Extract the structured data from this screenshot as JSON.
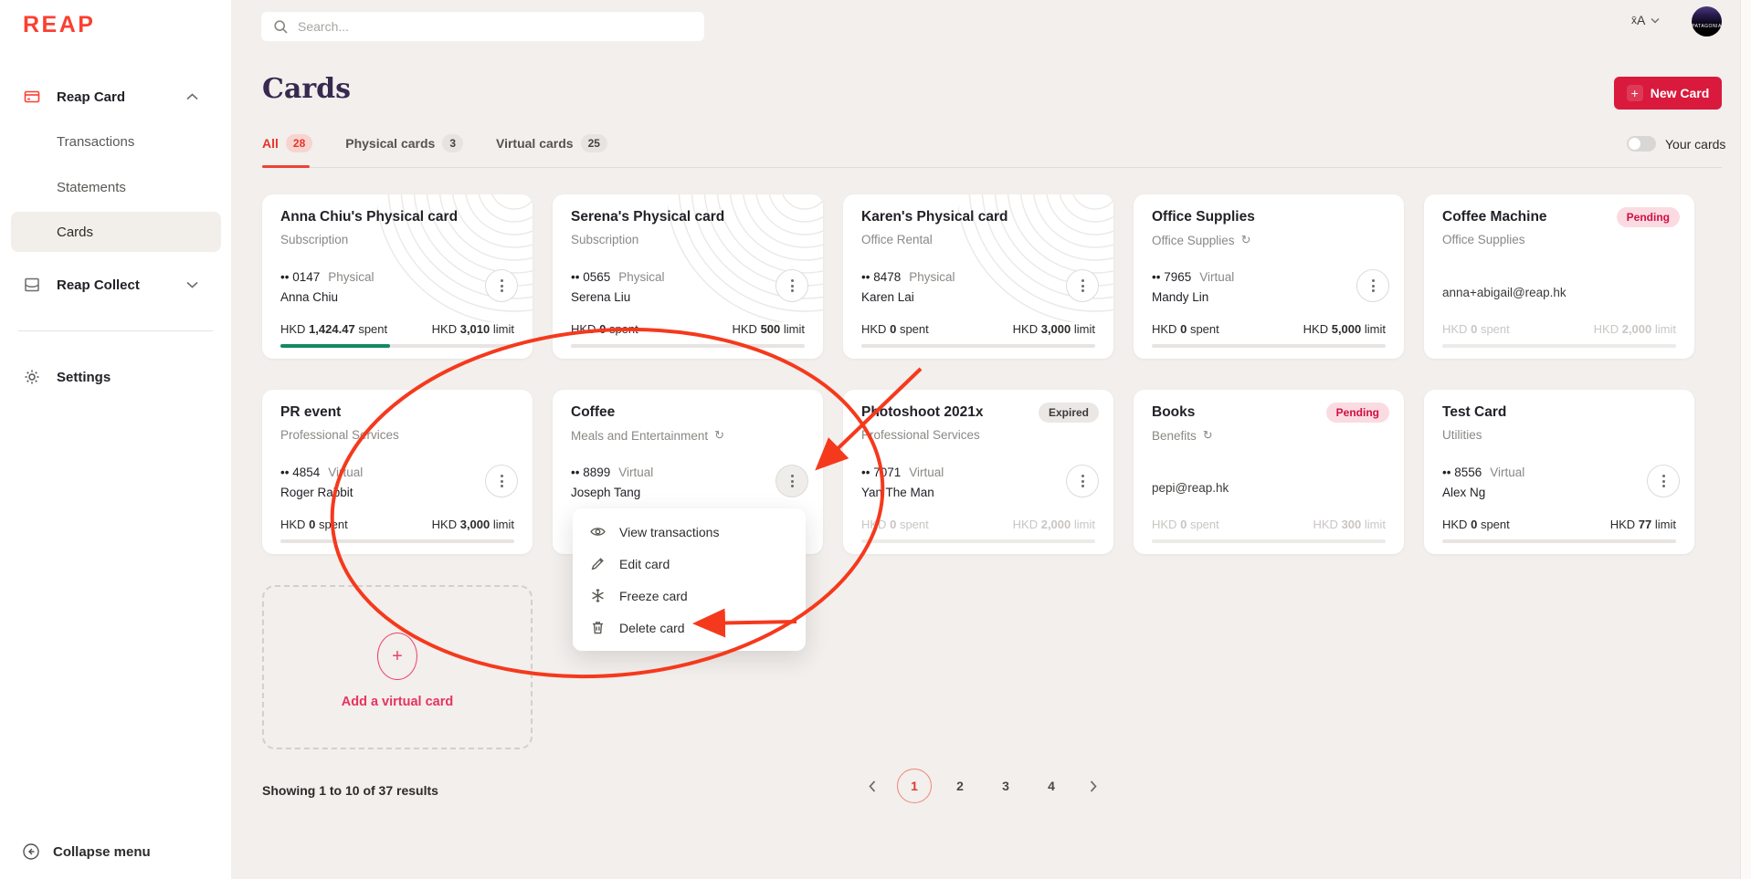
{
  "colors": {
    "brand_red": "#fb3f30",
    "button_red": "#d91a3c",
    "tab_active_red": "#e5352b",
    "pending_bg": "#fbdbe2",
    "pending_text": "#cf0f42",
    "progress_green": "#108a63",
    "annotation_red": "#f5391d",
    "heading_purple": "#37294f",
    "background": "#f2efec"
  },
  "icons": {
    "recurring": "↻",
    "lang_x": "x̄",
    "lang_a": "A",
    "plus": "+",
    "avatar_label": "PATAGONIA"
  },
  "labels": {
    "currency": "HKD",
    "spent": "spent",
    "limit": "limit"
  },
  "sidebar": {
    "logo": "REAP",
    "reap_card": "Reap Card",
    "transactions": "Transactions",
    "statements": "Statements",
    "cards": "Cards",
    "reap_collect": "Reap Collect",
    "settings": "Settings",
    "collapse": "Collapse menu"
  },
  "topbar": {
    "search_placeholder": "Search..."
  },
  "header": {
    "title": "Cards",
    "new_card": "New Card"
  },
  "tabs": {
    "all": {
      "label": "All",
      "count": "28"
    },
    "physical": {
      "label": "Physical cards",
      "count": "3"
    },
    "virtual": {
      "label": "Virtual cards",
      "count": "25"
    },
    "your_cards": "Your cards"
  },
  "cards": [
    {
      "title": "Anna Chiu's Physical card",
      "category": "Subscription",
      "number": "•• 0147",
      "kind": "Physical",
      "holder": "Anna Chiu",
      "spent": "1,424.47",
      "limit": "3,010",
      "progress_style": "width:47%"
    },
    {
      "title": "Serena's Physical card",
      "category": "Subscription",
      "number": "•• 0565",
      "kind": "Physical",
      "holder": "Serena Liu",
      "spent": "0",
      "limit": "500"
    },
    {
      "title": "Karen's Physical card",
      "category": "Office Rental",
      "number": "•• 8478",
      "kind": "Physical",
      "holder": "Karen Lai",
      "spent": "0",
      "limit": "3,000"
    },
    {
      "title": "Office Supplies",
      "category": "Office Supplies",
      "number": "•• 7965",
      "kind": "Virtual",
      "holder": "Mandy Lin",
      "spent": "0",
      "limit": "5,000"
    },
    {
      "title": "Coffee Machine",
      "badge": "Pending",
      "category": "Office Supplies",
      "email": "anna+abigail@reap.hk",
      "spent": "0",
      "limit": "2,000"
    },
    {
      "title": "PR event",
      "category": "Professional Services",
      "number": "•• 4854",
      "kind": "Virtual",
      "holder": "Roger Rabbit",
      "spent": "0",
      "limit": "3,000"
    },
    {
      "title": "Coffee",
      "category": "Meals and Entertainment",
      "number": "•• 8899",
      "kind": "Virtual",
      "holder": "Joseph Tang"
    },
    {
      "title": "Photoshoot 2021x",
      "badge": "Expired",
      "category": "Professional Services",
      "number": "•• 7071",
      "kind": "Virtual",
      "holder": "Yan The Man",
      "spent": "0",
      "limit": "2,000"
    },
    {
      "title": "Books",
      "badge": "Pending",
      "category": "Benefits",
      "email": "pepi@reap.hk",
      "spent": "0",
      "limit": "300"
    },
    {
      "title": "Test Card",
      "category": "Utilities",
      "number": "•• 8556",
      "kind": "Virtual",
      "holder": "Alex Ng",
      "spent": "0",
      "limit": "77"
    }
  ],
  "menu": {
    "items": [
      {
        "label": "View transactions"
      },
      {
        "label": "Edit card"
      },
      {
        "label": "Freeze card"
      },
      {
        "label": "Delete card"
      }
    ]
  },
  "add_tile": {
    "label": "Add a virtual card"
  },
  "footer": {
    "showing": "Showing 1 to 10 of 37 results",
    "pages": [
      "1",
      "2",
      "3",
      "4"
    ],
    "current": "1"
  }
}
